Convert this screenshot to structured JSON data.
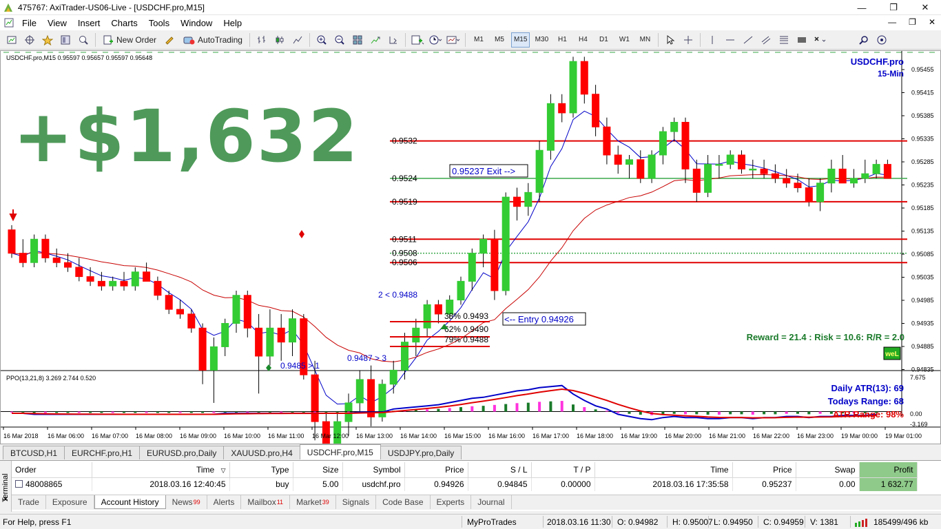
{
  "window": {
    "title": "475767: AxiTrader-US06-Live - [USDCHF.pro,M15]",
    "controls": [
      "—",
      "❐",
      "✕"
    ]
  },
  "menu": {
    "items": [
      "File",
      "View",
      "Insert",
      "Charts",
      "Tools",
      "Window",
      "Help"
    ],
    "mdi": [
      "—",
      "❐",
      "✕"
    ]
  },
  "toolbar": {
    "new_order": "New Order",
    "autotrading": "AutoTrading",
    "timeframes": [
      "M1",
      "M5",
      "M15",
      "M30",
      "H1",
      "H4",
      "D1",
      "W1",
      "MN"
    ],
    "active_timeframe": "M15"
  },
  "chart": {
    "header": "USDCHF.pro,M15  0.95597 0.95657 0.95597 0.95648",
    "symbol": "USDCHF.pro",
    "period": "15-Min",
    "big_profit": "+$1,632",
    "exit_label": "0.95237 Exit -->",
    "entry_label": "<-- Entry 0.94926",
    "reward_risk": "Reward = 21.4 : Risk = 10.6: R/R = 2.0",
    "badge": "weL",
    "swing_labels": [
      "2 < 0.9488",
      "0.9485 > 1",
      "0.9487 > 3"
    ],
    "fib_labels": [
      "38% 0.9493",
      "62% 0.9490",
      "79% 0.9488"
    ],
    "level_labels": [
      "0.9532",
      "0.9524",
      "0.9519",
      "0.9511",
      "0.9508",
      "0.9506"
    ],
    "price_axis": [
      "0.95455",
      "0.95415",
      "0.95385",
      "0.95335",
      "0.95285",
      "0.95235",
      "0.95185",
      "0.95135",
      "0.95085",
      "0.95035",
      "0.94985",
      "0.94935",
      "0.94885",
      "0.94835"
    ],
    "time_axis": [
      "16 Mar 2018",
      "16 Mar 06:00",
      "16 Mar 07:00",
      "16 Mar 08:00",
      "16 Mar 09:00",
      "16 Mar 10:00",
      "16 Mar 11:00",
      "16 Mar 12:00",
      "16 Mar 13:00",
      "16 Mar 14:00",
      "16 Mar 15:00",
      "16 Mar 16:00",
      "16 Mar 17:00",
      "16 Mar 18:00",
      "16 Mar 19:00",
      "16 Mar 20:00",
      "16 Mar 21:00",
      "16 Mar 22:00",
      "16 Mar 23:00",
      "19 Mar 00:00",
      "19 Mar 01:00"
    ]
  },
  "indicator": {
    "header": "PPO(13,21,8) 3.269 2.744 0.520",
    "daily_atr": "Daily ATR(13): 69",
    "todays_range": "Todays Range: 68",
    "atr_range": "ATR Range: 98%",
    "axis": [
      "7.675",
      "0.00",
      "-3.169"
    ]
  },
  "colors": {
    "bull": "#33cc33",
    "bear": "#ff0000",
    "level_red": "#e00000",
    "level_green": "#3aa84a",
    "fast_ma": "#0000c8",
    "slow_ma": "#c80000",
    "big_profit": "#4f9a5a",
    "profit_highlight": "#8fca8a"
  },
  "chart_tabs": {
    "items": [
      "BTCUSD,H1",
      "EURCHF.pro,H1",
      "EURUSD.pro,Daily",
      "XAUUSD.pro,H4",
      "USDCHF.pro,M15",
      "USDJPY.pro,Daily"
    ],
    "active": 4
  },
  "terminal": {
    "side_label": "Terminal",
    "close": "✕",
    "columns": [
      "Order",
      "Time",
      "Type",
      "Size",
      "Symbol",
      "Price",
      "S / L",
      "T / P",
      "Time",
      "Price",
      "Swap",
      "Profit"
    ],
    "sort_indicator": "▽",
    "rows": [
      {
        "order": "48008865",
        "open_time": "2018.03.16 12:40:45",
        "type": "buy",
        "size": "5.00",
        "symbol": "usdchf.pro",
        "price": "0.94926",
        "sl": "0.94845",
        "tp": "0.00000",
        "close_time": "2018.03.16 17:35:58",
        "close_price": "0.95237",
        "swap": "0.00",
        "profit": "1 632.77"
      }
    ],
    "tabs": [
      {
        "label": "Trade",
        "badge": ""
      },
      {
        "label": "Exposure",
        "badge": ""
      },
      {
        "label": "Account History",
        "badge": ""
      },
      {
        "label": "News",
        "badge": "99"
      },
      {
        "label": "Alerts",
        "badge": ""
      },
      {
        "label": "Mailbox",
        "badge": "11"
      },
      {
        "label": "Market",
        "badge": "39"
      },
      {
        "label": "Signals",
        "badge": ""
      },
      {
        "label": "Code Base",
        "badge": ""
      },
      {
        "label": "Experts",
        "badge": ""
      },
      {
        "label": "Journal",
        "badge": ""
      }
    ],
    "active_tab": 2
  },
  "status": {
    "help": "For Help, press F1",
    "profile": "MyProTrades",
    "datetime": "2018.03.16 11:30",
    "open": "O: 0.94982",
    "high": "H: 0.95007",
    "low": "L: 0.94950",
    "close": "C: 0.94959",
    "volume": "V: 1381",
    "traffic": "185499/496 kb"
  },
  "chart_data": {
    "type": "candlestick",
    "y_range": [
      0.94835,
      0.9548
    ],
    "candles": [
      [
        0.9513,
        0.9514,
        0.9507,
        0.9508
      ],
      [
        0.9508,
        0.9511,
        0.9505,
        0.9506
      ],
      [
        0.9506,
        0.9512,
        0.9505,
        0.9511
      ],
      [
        0.9511,
        0.9512,
        0.9506,
        0.9507
      ],
      [
        0.9507,
        0.9509,
        0.9505,
        0.9506
      ],
      [
        0.9506,
        0.9508,
        0.9504,
        0.9505
      ],
      [
        0.9505,
        0.9507,
        0.9502,
        0.9503
      ],
      [
        0.9503,
        0.9505,
        0.9501,
        0.9502
      ],
      [
        0.9502,
        0.9504,
        0.95,
        0.9501
      ],
      [
        0.9501,
        0.9503,
        0.95,
        0.9502
      ],
      [
        0.9502,
        0.9504,
        0.95,
        0.9501
      ],
      [
        0.9501,
        0.9505,
        0.95,
        0.9504
      ],
      [
        0.9504,
        0.9506,
        0.9502,
        0.9502
      ],
      [
        0.9502,
        0.9503,
        0.9498,
        0.9499
      ],
      [
        0.9499,
        0.95,
        0.9495,
        0.9496
      ],
      [
        0.9496,
        0.9498,
        0.9494,
        0.9495
      ],
      [
        0.9495,
        0.9496,
        0.9491,
        0.9492
      ],
      [
        0.9492,
        0.9493,
        0.948,
        0.9483
      ],
      [
        0.9483,
        0.949,
        0.9476,
        0.9488
      ],
      [
        0.9488,
        0.9494,
        0.9486,
        0.9493
      ],
      [
        0.9493,
        0.95,
        0.9491,
        0.9499
      ],
      [
        0.9499,
        0.95,
        0.949,
        0.9492
      ],
      [
        0.9492,
        0.9495,
        0.9478,
        0.9486
      ],
      [
        0.9486,
        0.9496,
        0.9484,
        0.9492
      ],
      [
        0.9492,
        0.9495,
        0.9485,
        0.9489
      ],
      [
        0.9489,
        0.9496,
        0.9486,
        0.9494
      ],
      [
        0.9494,
        0.9495,
        0.9481,
        0.9482
      ],
      [
        0.9482,
        0.9485,
        0.9468,
        0.9472
      ],
      [
        0.9472,
        0.9474,
        0.9463,
        0.9467
      ],
      [
        0.9467,
        0.9474,
        0.9465,
        0.9472
      ],
      [
        0.9472,
        0.9478,
        0.9469,
        0.9476
      ],
      [
        0.9476,
        0.9483,
        0.9474,
        0.9481
      ],
      [
        0.9481,
        0.9484,
        0.9471,
        0.9473
      ],
      [
        0.9473,
        0.9481,
        0.9472,
        0.948
      ],
      [
        0.948,
        0.9485,
        0.9478,
        0.9483
      ],
      [
        0.9483,
        0.9491,
        0.9481,
        0.9489
      ],
      [
        0.9489,
        0.9494,
        0.9486,
        0.9492
      ],
      [
        0.9492,
        0.9498,
        0.949,
        0.9497
      ],
      [
        0.9497,
        0.9498,
        0.9493,
        0.9495
      ],
      [
        0.9495,
        0.9499,
        0.9494,
        0.9498
      ],
      [
        0.9498,
        0.9503,
        0.9497,
        0.9502
      ],
      [
        0.9502,
        0.9509,
        0.95,
        0.9508
      ],
      [
        0.9508,
        0.9512,
        0.9505,
        0.9511
      ],
      [
        0.9511,
        0.9513,
        0.9498,
        0.95
      ],
      [
        0.95,
        0.9521,
        0.9499,
        0.952
      ],
      [
        0.952,
        0.9522,
        0.9515,
        0.9518
      ],
      [
        0.9518,
        0.9523,
        0.9516,
        0.9521
      ],
      [
        0.9521,
        0.9532,
        0.9519,
        0.953
      ],
      [
        0.953,
        0.9542,
        0.9528,
        0.954
      ],
      [
        0.954,
        0.9542,
        0.9536,
        0.9538
      ],
      [
        0.9538,
        0.955,
        0.9537,
        0.9549
      ],
      [
        0.9549,
        0.955,
        0.954,
        0.9542
      ],
      [
        0.9542,
        0.9544,
        0.9533,
        0.9535
      ],
      [
        0.9535,
        0.9537,
        0.9527,
        0.9529
      ],
      [
        0.9529,
        0.9531,
        0.9525,
        0.9527
      ],
      [
        0.9527,
        0.9529,
        0.9524,
        0.9528
      ],
      [
        0.9528,
        0.953,
        0.9523,
        0.9524
      ],
      [
        0.9524,
        0.953,
        0.9523,
        0.9529
      ],
      [
        0.9529,
        0.9535,
        0.9527,
        0.9534
      ],
      [
        0.9534,
        0.9537,
        0.9532,
        0.9536
      ],
      [
        0.9536,
        0.9537,
        0.9523,
        0.9526
      ],
      [
        0.9526,
        0.9528,
        0.9519,
        0.9521
      ],
      [
        0.9521,
        0.9529,
        0.952,
        0.9527
      ],
      [
        0.9527,
        0.9529,
        0.9524,
        0.9527
      ],
      [
        0.9527,
        0.953,
        0.9526,
        0.9529
      ],
      [
        0.9529,
        0.953,
        0.9525,
        0.9526
      ],
      [
        0.9526,
        0.9528,
        0.9524,
        0.9526
      ],
      [
        0.9526,
        0.9528,
        0.9524,
        0.9525
      ],
      [
        0.9525,
        0.9527,
        0.9523,
        0.9524
      ],
      [
        0.9524,
        0.9526,
        0.9522,
        0.9523
      ],
      [
        0.9523,
        0.9525,
        0.9521,
        0.9522
      ],
      [
        0.9522,
        0.9524,
        0.9518,
        0.9519
      ],
      [
        0.9519,
        0.9524,
        0.9517,
        0.9523
      ],
      [
        0.9523,
        0.9528,
        0.9521,
        0.9526
      ],
      [
        0.9526,
        0.9529,
        0.9523,
        0.9523
      ],
      [
        0.9523,
        0.9526,
        0.9522,
        0.9524
      ],
      [
        0.9524,
        0.9528,
        0.9523,
        0.9525
      ],
      [
        0.9525,
        0.9528,
        0.9524,
        0.9527
      ],
      [
        0.9527,
        0.9528,
        0.9524,
        0.9524
      ]
    ],
    "levels": [
      {
        "price": 0.9532,
        "color": "red"
      },
      {
        "price": 0.9524,
        "color": "green"
      },
      {
        "price": 0.9519,
        "color": "red"
      },
      {
        "price": 0.9511,
        "color": "red"
      },
      {
        "price": 0.9508,
        "color": "green",
        "dotted": true
      },
      {
        "price": 0.9506,
        "color": "red"
      }
    ],
    "ppo_histogram": [
      -0.2,
      -0.2,
      -0.3,
      -0.3,
      -0.3,
      -0.3,
      -0.3,
      -0.3,
      -0.3,
      -0.3,
      -0.3,
      -0.3,
      -0.3,
      -0.3,
      -0.3,
      -0.3,
      -0.3,
      -0.3,
      -0.3,
      -0.2,
      -0.2,
      -0.2,
      -0.2,
      -0.2,
      -0.2,
      -0.2,
      -0.2,
      -0.2,
      -0.2,
      -0.2,
      -0.2,
      -0.1,
      -0.1,
      -0.1,
      0.2,
      0.3,
      0.4,
      0.5,
      0.6,
      0.8,
      1.0,
      1.2,
      1.3,
      1.5,
      1.7,
      1.9,
      2.0,
      2.2,
      2.3,
      2.4,
      1.6,
      1.0,
      0.5,
      0.2,
      -0.3,
      -0.5,
      -0.7,
      -0.8,
      -0.6,
      -0.5,
      -0.6,
      -0.6,
      -0.7,
      -0.7,
      -0.6,
      -0.6,
      -0.7,
      -0.6,
      -0.6,
      -0.5,
      -0.5,
      -0.6,
      -0.5,
      -0.5,
      -0.4,
      -0.4,
      -0.4,
      -0.3
    ],
    "ppo_range": [
      -3.169,
      7.675
    ]
  }
}
